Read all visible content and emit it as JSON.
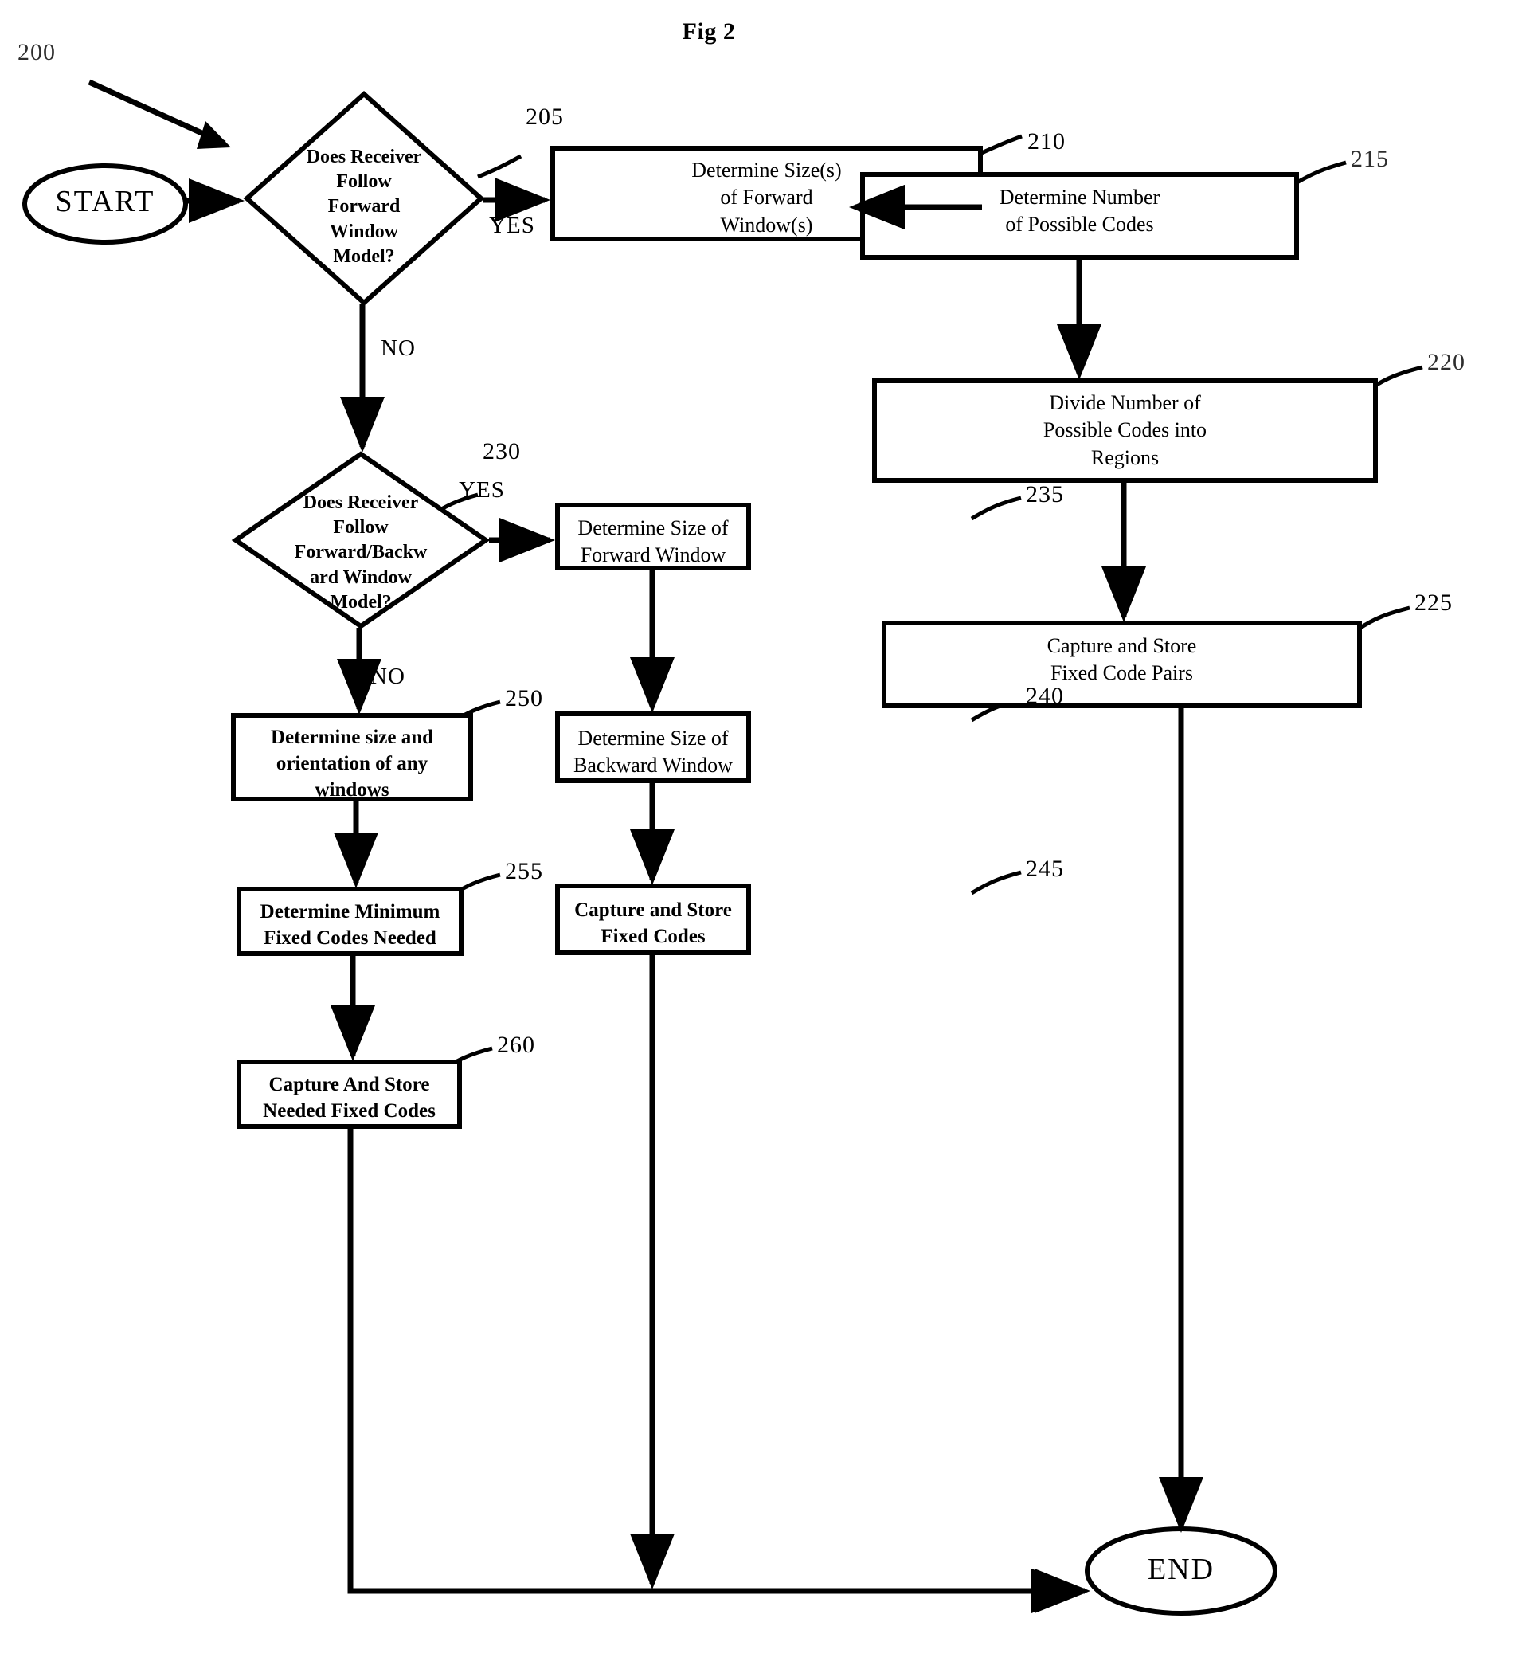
{
  "figure": {
    "title": "Fig 2",
    "diagram_ref": "200"
  },
  "nodes": {
    "start": {
      "label": "START",
      "shape": "terminator"
    },
    "end": {
      "label": "END",
      "shape": "terminator"
    },
    "d205": {
      "ref": "205",
      "label": "Does Receiver\nFollow\nForward\nWindow\nModel?",
      "shape": "decision"
    },
    "b210": {
      "ref": "210",
      "label": "Determine Size(s)\nof Forward\nWindow(s)",
      "shape": "process"
    },
    "b215": {
      "ref": "215",
      "label": "Determine Number\nof Possible Codes",
      "shape": "process"
    },
    "b220": {
      "ref": "220",
      "label": "Divide Number of\nPossible Codes into\nRegions",
      "shape": "process"
    },
    "b225": {
      "ref": "225",
      "label": "Capture and Store\nFixed Code Pairs",
      "shape": "process"
    },
    "d230": {
      "ref": "230",
      "label": "Does Receiver\nFollow\nForward/Backw\nard Window\nModel?",
      "shape": "decision"
    },
    "b235": {
      "ref": "235",
      "label": "Determine Size of\nForward Window",
      "shape": "process"
    },
    "b240": {
      "ref": "240",
      "label": "Determine Size of\nBackward Window",
      "shape": "process"
    },
    "b245": {
      "ref": "245",
      "label": "Capture and Store\nFixed Codes",
      "shape": "process"
    },
    "b250": {
      "ref": "250",
      "label": "Determine size and\norientation of any\nwindows",
      "shape": "process"
    },
    "b255": {
      "ref": "255",
      "label": "Determine Minimum\nFixed Codes Needed",
      "shape": "process"
    },
    "b260": {
      "ref": "260",
      "label": "Capture And Store\nNeeded Fixed Codes",
      "shape": "process"
    }
  },
  "edge_labels": {
    "yes_205": "YES",
    "no_205": "NO",
    "yes_230": "YES",
    "no_230": "NO"
  },
  "colors": {
    "ink": "#000000",
    "paper": "#ffffff"
  }
}
